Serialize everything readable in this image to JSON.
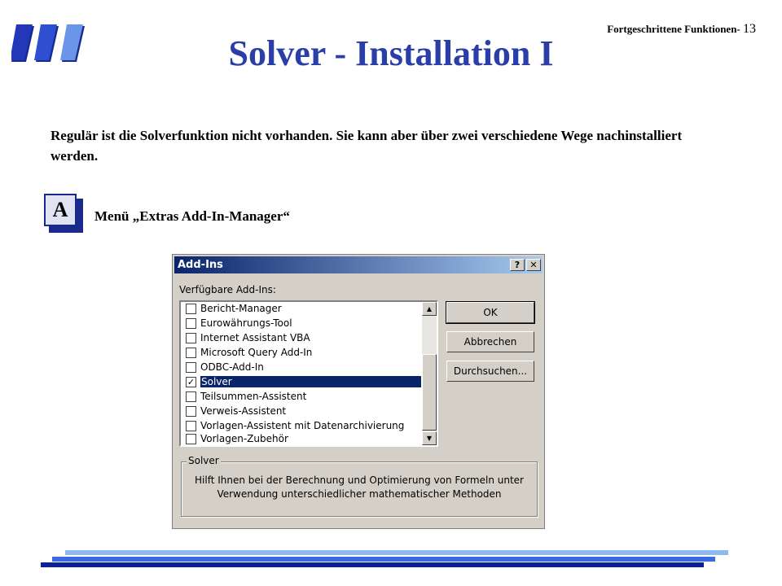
{
  "header": {
    "section": "Fortgeschrittene Funktionen-",
    "page_number": "13",
    "title": "Solver - Installation I"
  },
  "intro_text": "Regulär ist die Solverfunktion nicht vorhanden. Sie kann aber über zwei verschiedene Wege nachinstalliert werden.",
  "step": {
    "badge": "A",
    "label": "Menü „Extras Add-In-Manager“"
  },
  "dialog": {
    "title": "Add-Ins",
    "help_button": "?",
    "close_button": "✕",
    "available_label": "Verfügbare Add-Ins:",
    "items": [
      {
        "label": "Bericht-Manager",
        "checked": false,
        "selected": false
      },
      {
        "label": "Eurowährungs-Tool",
        "checked": false,
        "selected": false
      },
      {
        "label": "Internet Assistant VBA",
        "checked": false,
        "selected": false
      },
      {
        "label": "Microsoft Query Add-In",
        "checked": false,
        "selected": false
      },
      {
        "label": "ODBC-Add-In",
        "checked": false,
        "selected": false
      },
      {
        "label": "Solver",
        "checked": true,
        "selected": true
      },
      {
        "label": "Teilsummen-Assistent",
        "checked": false,
        "selected": false
      },
      {
        "label": "Verweis-Assistent",
        "checked": false,
        "selected": false
      },
      {
        "label": "Vorlagen-Assistent mit Datenarchivierung",
        "checked": false,
        "selected": false
      },
      {
        "label": "Vorlagen-Zubehör",
        "checked": false,
        "selected": false
      }
    ],
    "buttons": {
      "ok": "OK",
      "cancel": "Abbrechen",
      "browse": "Durchsuchen..."
    },
    "description_group": {
      "legend": "Solver",
      "line1": "Hilft Ihnen bei der Berechnung und Optimierung von Formeln unter",
      "line2": "Verwendung unterschiedlicher mathematischer Methoden"
    }
  },
  "colors": {
    "title": "#2b3ea8",
    "titlebar_start": "#0a246a",
    "titlebar_end": "#a6caf0",
    "selection": "#0a246a",
    "bar_light": "#8fbaf0",
    "bar_mid": "#3a6ae0",
    "bar_dark": "#0d1f9e"
  },
  "icons": {
    "logo": "three-slanted-blue-bars-logo",
    "scroll_up": "up-arrow-icon",
    "scroll_down": "down-arrow-icon",
    "check": "check-icon"
  }
}
